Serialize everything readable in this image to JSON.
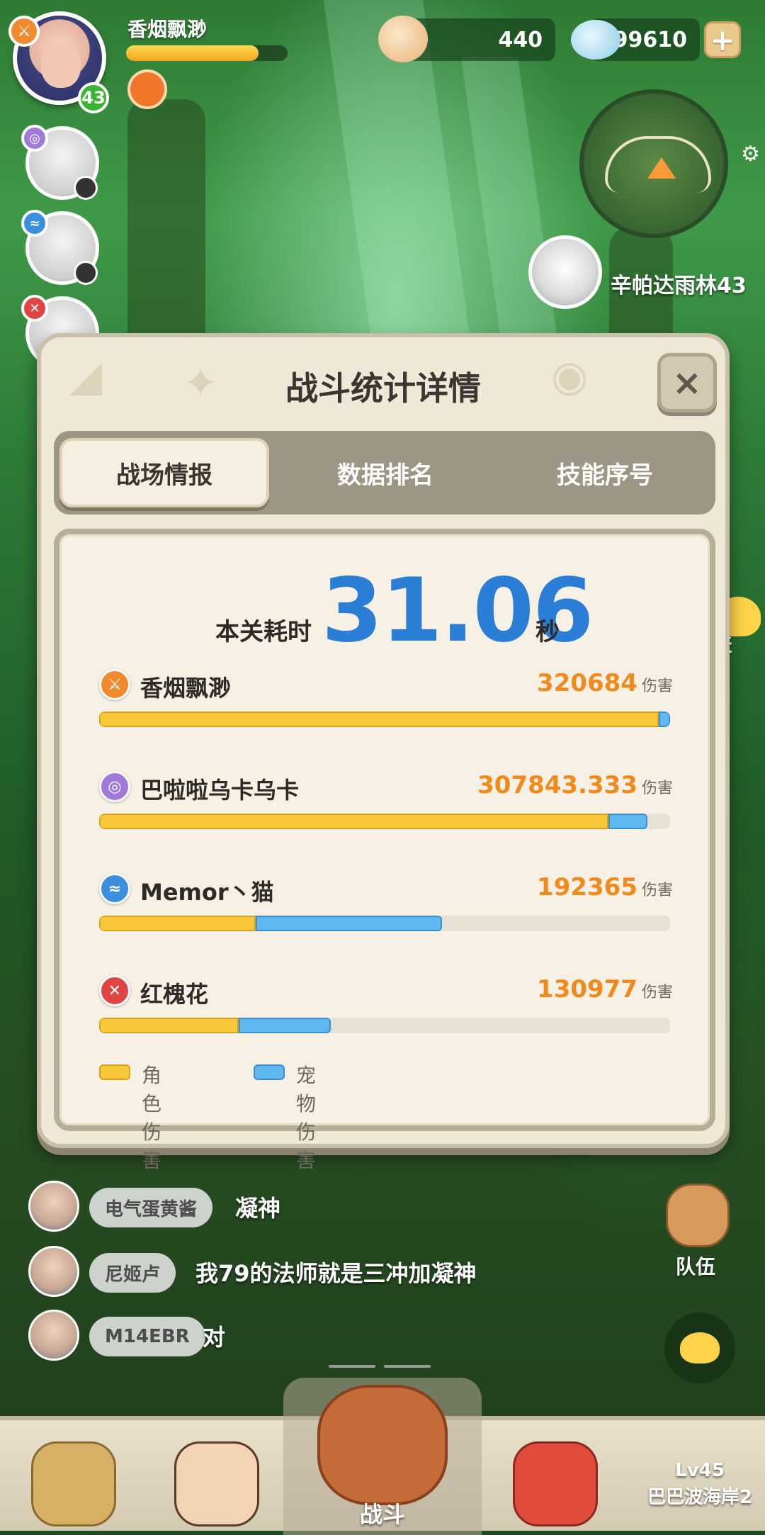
{
  "header": {
    "player_name": "香烟飘渺",
    "player_level": "43",
    "hp_fraction": 0.82,
    "currency_shells": "440",
    "currency_gems": "99610",
    "plus_label": "+"
  },
  "map": {
    "location_name": "辛帕达雨林43"
  },
  "side": {
    "chat_label": "聊天",
    "team_label": "队伍"
  },
  "dialog": {
    "title": "战斗统计详情",
    "close_label": "×",
    "tabs": [
      {
        "label": "战场情报",
        "active": true
      },
      {
        "label": "数据排名",
        "active": false
      },
      {
        "label": "技能序号",
        "active": false
      }
    ],
    "time_label": "本关耗时",
    "time_value": "31.06",
    "time_unit": "秒",
    "damage_unit": "伤害",
    "entries": [
      {
        "name": "香烟飘渺",
        "damage": "320684",
        "role_fraction": 0.98,
        "pet_fraction": 0.02,
        "icon_color": "#f08a2c",
        "icon": "sword-class-icon"
      },
      {
        "name": "巴啦啦乌卡乌卡",
        "damage": "307843.333",
        "role_fraction": 0.892,
        "pet_fraction": 0.068,
        "icon_color": "#a07ad8",
        "icon": "swirl-class-icon"
      },
      {
        "name": "Memor丶猫",
        "damage": "192365",
        "role_fraction": 0.274,
        "pet_fraction": 0.326,
        "icon_color": "#3b8fdc",
        "icon": "wave-class-icon"
      },
      {
        "name": "红槐花",
        "damage": "130977",
        "role_fraction": 0.244,
        "pet_fraction": 0.162,
        "icon_color": "#e04444",
        "icon": "shield-class-icon"
      }
    ],
    "legend": {
      "role_label": "角色伤害",
      "pet_label": "宠物伤害",
      "role_color": "#f8c83a",
      "pet_color": "#5fb8f0"
    }
  },
  "chat": {
    "messages": [
      {
        "user": "电气蛋黄酱",
        "text": "凝神"
      },
      {
        "user": "尼姬卢",
        "text": "我79的法师就是三冲加凝神"
      },
      {
        "user": "M14EBR",
        "text": "对"
      }
    ]
  },
  "bottom_nav": {
    "center_label": "战斗",
    "locked_level": "Lv45",
    "locked_name": "巴巴波海岸2"
  }
}
